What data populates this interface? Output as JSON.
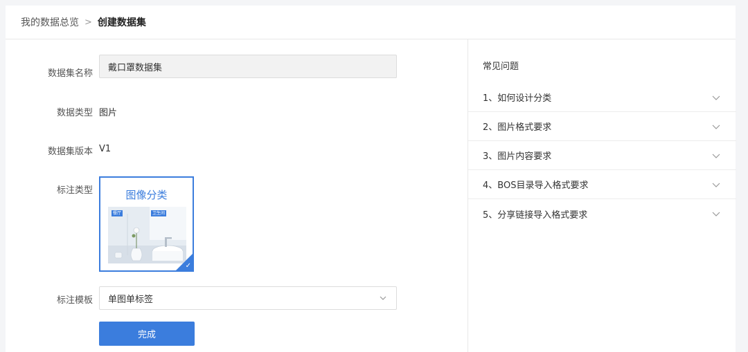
{
  "breadcrumb": {
    "parent": "我的数据总览",
    "separator": ">",
    "current": "创建数据集"
  },
  "form": {
    "name_label": "数据集名称",
    "name_value": "戴口罩数据集",
    "type_label": "数据类型",
    "type_value": "图片",
    "version_label": "数据集版本",
    "version_value": "V1",
    "annotation_type_label": "标注类型",
    "annotation_card": {
      "title": "图像分类",
      "tag_1": "餐厅",
      "tag_2": "卫生间",
      "selected": true
    },
    "template_label": "标注模板",
    "template_value": "单图单标签",
    "submit_label": "完成"
  },
  "faq": {
    "title": "常见问题",
    "items": [
      {
        "label": "1、如何设计分类"
      },
      {
        "label": "2、图片格式要求"
      },
      {
        "label": "3、图片内容要求"
      },
      {
        "label": "4、BOS目录导入格式要求"
      },
      {
        "label": "5、分享链接导入格式要求"
      }
    ]
  },
  "colors": {
    "accent": "#3b7ddd",
    "background": "#f4f5f7"
  }
}
